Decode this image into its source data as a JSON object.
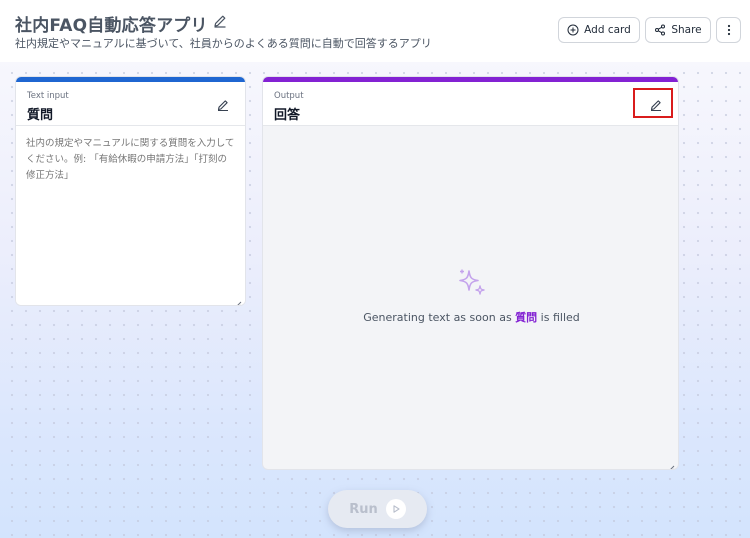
{
  "app": {
    "title": "社内FAQ自動応答アプリ",
    "description": "社内規定やマニュアルに基づいて、社員からのよくある質問に自動で回答するアプリ"
  },
  "toolbar": {
    "add_card_label": "Add card",
    "share_label": "Share",
    "more_icon": "vertical-dots-icon"
  },
  "input_card": {
    "kind_label": "Text input",
    "name": "質問",
    "placeholder": "社内の規定やマニュアルに関する質問を入力してください。例: 「有給休暇の申請方法」「打刻の修正方法」",
    "accent_color": "#1f66d1"
  },
  "output_card": {
    "kind_label": "Output",
    "name": "回答",
    "status_prefix": "Generating text as soon as",
    "status_field": "質問",
    "status_suffix": "is filled",
    "accent_color": "#8322d3"
  },
  "run": {
    "label": "Run"
  }
}
